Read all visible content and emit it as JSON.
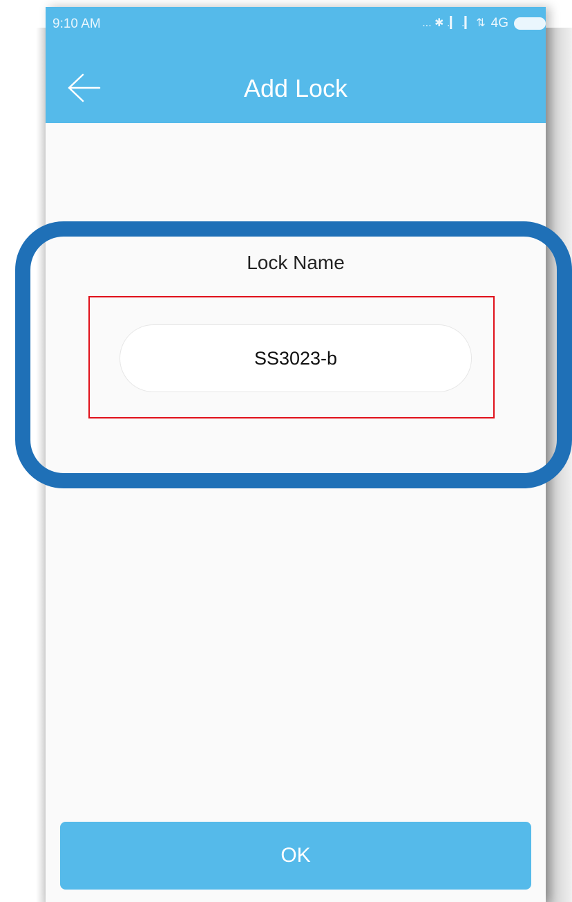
{
  "status_bar": {
    "time": "9:10 AM",
    "indicators": "... ✱ .▎ .▎ ⇅",
    "network": "4G"
  },
  "header": {
    "back_icon": "arrow-left-icon",
    "title": "Add Lock"
  },
  "form": {
    "lock_name_label": "Lock Name",
    "lock_name_value": "SS3023-b"
  },
  "actions": {
    "ok_label": "OK"
  },
  "colors": {
    "app_bar": "#55baea",
    "highlight_frame": "#1f70b7",
    "annotation_box": "#e0101a"
  }
}
